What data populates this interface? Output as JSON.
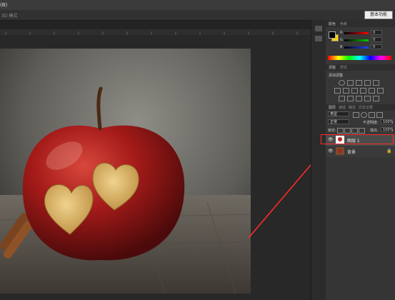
{
  "menubar": {
    "title": "(B)"
  },
  "workspace": {
    "label": "基本功能"
  },
  "options": {
    "label": "3D 模式"
  },
  "color_panel": {
    "tabs": [
      "颜色",
      "色板"
    ],
    "channels": [
      {
        "label": "R",
        "value": "0"
      },
      {
        "label": "G",
        "value": "0"
      },
      {
        "label": "B",
        "value": "0"
      }
    ],
    "foreground": "#000000",
    "background": "#ffd400"
  },
  "adjust_panel": {
    "tabs": [
      "调整",
      "样式"
    ],
    "title": "添加调整"
  },
  "layers_panel": {
    "tabs": [
      "图层",
      "通道",
      "路径",
      "历史记录"
    ],
    "filter": "类型",
    "blend_mode": "正常",
    "opacity_label": "不透明度:",
    "opacity_value": "100%",
    "lock_label": "锁定:",
    "fill_label": "填充:",
    "fill_value": "100%",
    "layers": [
      {
        "name": "图层 1",
        "selected": true
      },
      {
        "name": "背景",
        "selected": false
      }
    ]
  },
  "colors": {
    "highlight": "#ff2a2a",
    "panel": "#373737"
  }
}
